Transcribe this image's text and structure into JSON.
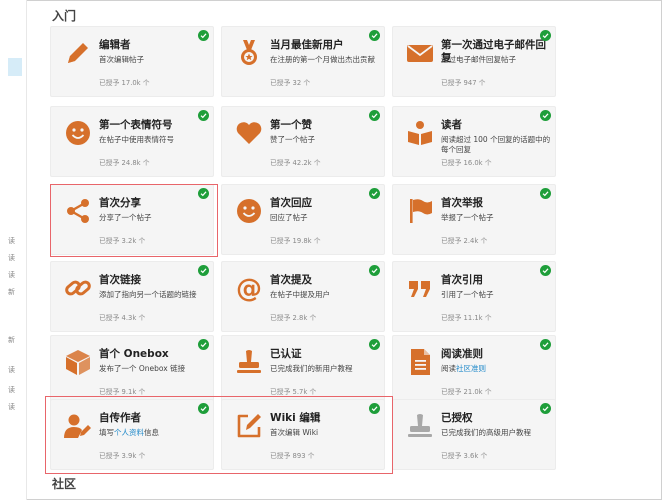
{
  "sections": {
    "getting_started": "入门",
    "community": "社区"
  },
  "left_chars": [
    "读",
    "读",
    "读",
    "新",
    "新",
    "读",
    "读",
    "读"
  ],
  "badges": [
    {
      "name": "编辑者",
      "desc": "首次编辑帖子",
      "granted": "已授予 17.0k 个",
      "icon": "pencil-icon",
      "gray": false
    },
    {
      "name": "当月最佳新用户",
      "desc": "在注册的第一个月做出杰出贡献",
      "granted": "已授予 32 个",
      "icon": "medal-icon",
      "gray": false
    },
    {
      "name": "第一次通过电子邮件回复",
      "desc": "通过电子邮件回复帖子",
      "granted": "已授予 947 个",
      "icon": "envelope-icon",
      "gray": false
    },
    {
      "name": "第一个表情符号",
      "desc": "在帖子中使用表情符号",
      "granted": "已授予 24.8k 个",
      "icon": "smile-icon",
      "gray": false
    },
    {
      "name": "第一个赞",
      "desc": "赞了一个帖子",
      "granted": "已授予 42.2k 个",
      "icon": "heart-icon",
      "gray": false
    },
    {
      "name": "读者",
      "desc": "阅读超过 100 个回复的话题中的每个回复",
      "granted": "已授予 16.0k 个",
      "icon": "book-icon",
      "gray": false
    },
    {
      "name": "首次分享",
      "desc": "分享了一个帖子",
      "granted": "已授予 3.2k 个",
      "icon": "share-icon",
      "gray": false
    },
    {
      "name": "首次回应",
      "desc": "回应了帖子",
      "granted": "已授予 19.8k 个",
      "icon": "smile-icon",
      "gray": false
    },
    {
      "name": "首次举报",
      "desc": "举报了一个帖子",
      "granted": "已授予 2.4k 个",
      "icon": "flag-icon",
      "gray": false
    },
    {
      "name": "首次链接",
      "desc": "添加了指向另一个话题的链接",
      "granted": "已授予 4.3k 个",
      "icon": "link-icon",
      "gray": false
    },
    {
      "name": "首次提及",
      "desc": "在帖子中提及用户",
      "granted": "已授予 2.8k 个",
      "icon": "at-icon",
      "gray": false
    },
    {
      "name": "首次引用",
      "desc": "引用了一个帖子",
      "granted": "已授予 11.1k 个",
      "icon": "quote-icon",
      "gray": false
    },
    {
      "name": "首个 Onebox",
      "desc": "发布了一个 Onebox 链接",
      "granted": "已授予 9.1k 个",
      "icon": "cube-icon",
      "gray": false
    },
    {
      "name": "已认证",
      "desc": "已完成我们的新用户教程",
      "granted": "已授予 5.7k 个",
      "icon": "stamp-icon",
      "gray": false
    },
    {
      "name": "阅读准则",
      "desc_pre": "阅读",
      "desc_link": "社区准则",
      "desc_post": "",
      "granted": "已授予 21.0k 个",
      "icon": "document-icon",
      "gray": false
    },
    {
      "name": "自传作者",
      "desc_pre": "填写",
      "desc_link": "个人资料",
      "desc_post": "信息",
      "granted": "已授予 3.9k 个",
      "icon": "user-edit-icon",
      "gray": false
    },
    {
      "name": "Wiki 编辑",
      "desc": "首次编辑 Wiki",
      "granted": "已授予 893 个",
      "icon": "pen-square-icon",
      "gray": false
    },
    {
      "name": "已授权",
      "desc": "已完成我们的高级用户教程",
      "granted": "已授予 3.6k 个",
      "icon": "stamp-icon",
      "gray": true
    }
  ],
  "colors": {
    "accent": "#d6702b",
    "check": "#1e9e3a",
    "link": "#1e88c9",
    "highlight": "#e8656a",
    "gray_icon": "#a8a8a8"
  }
}
